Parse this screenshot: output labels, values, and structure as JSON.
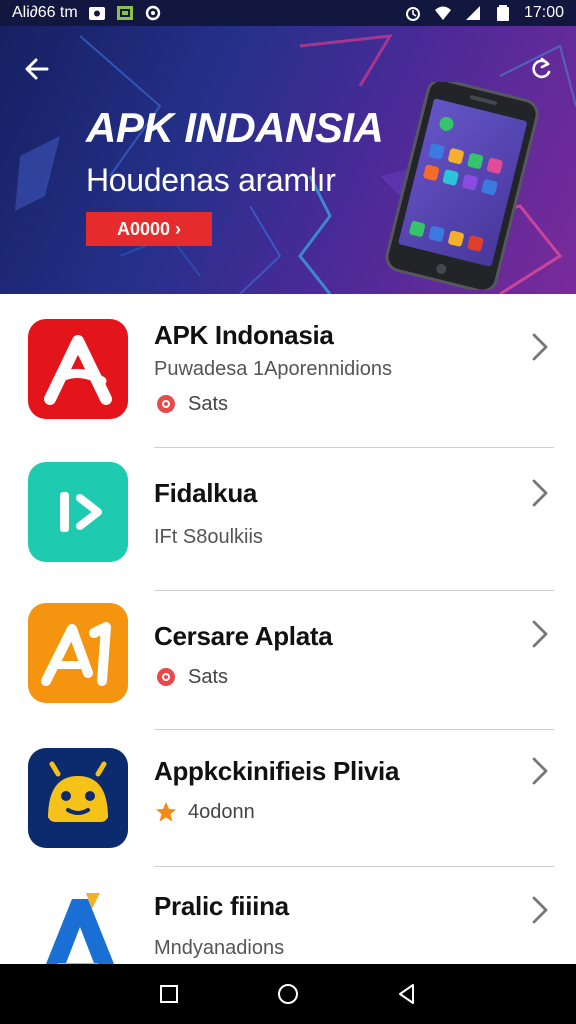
{
  "status_bar": {
    "left_text": "Ali∂66 tm",
    "time": "17:00",
    "icons": [
      "screenshot-icon",
      "gallery-icon",
      "sync-icon",
      "alarm-icon",
      "wifi-icon",
      "signal-icon",
      "battery-icon"
    ]
  },
  "hero": {
    "title": "APK INDANSIA",
    "subtitle": "Houdenas aramlır",
    "button_label": "A0000 ›",
    "back_icon": "back-arrow-icon",
    "refresh_icon": "refresh-icon",
    "image": "smartphone-illustration"
  },
  "apps": [
    {
      "name": "APK Indonasia",
      "subtitle": "Puwadesa 1Aporennidions",
      "meta_text": "Sats",
      "meta_icon": "flower-icon",
      "icon": "red-a-app-icon",
      "icon_color": "#e3151a"
    },
    {
      "name": "Fidalkua",
      "subtitle": "IFt S8oulkiis",
      "meta_text": "",
      "meta_icon": "",
      "icon": "teal-play-app-icon",
      "icon_color": "#1ecbb0"
    },
    {
      "name": "Cersare Aplata",
      "subtitle": "",
      "meta_text": "Sats",
      "meta_icon": "flower-icon",
      "icon": "orange-a-app-icon",
      "icon_color": "#f5950f"
    },
    {
      "name": "Appkckinifieis Plivia",
      "subtitle": "",
      "meta_text": "4odonn",
      "meta_icon": "star-icon",
      "icon": "android-robot-app-icon",
      "icon_color": "#0c2a6e"
    },
    {
      "name": "Pralic fiiina",
      "subtitle": "Mndyanadions",
      "meta_text": "",
      "meta_icon": "",
      "icon": "blue-a-app-icon",
      "icon_color": "#1a6fd4"
    }
  ],
  "nav_bar": {
    "icons": [
      "recents-icon",
      "home-icon",
      "back-icon"
    ]
  },
  "colors": {
    "hero_start": "#162061",
    "hero_end": "#7a2a9a",
    "accent_red": "#e52b2b",
    "star": "#f58a16"
  }
}
